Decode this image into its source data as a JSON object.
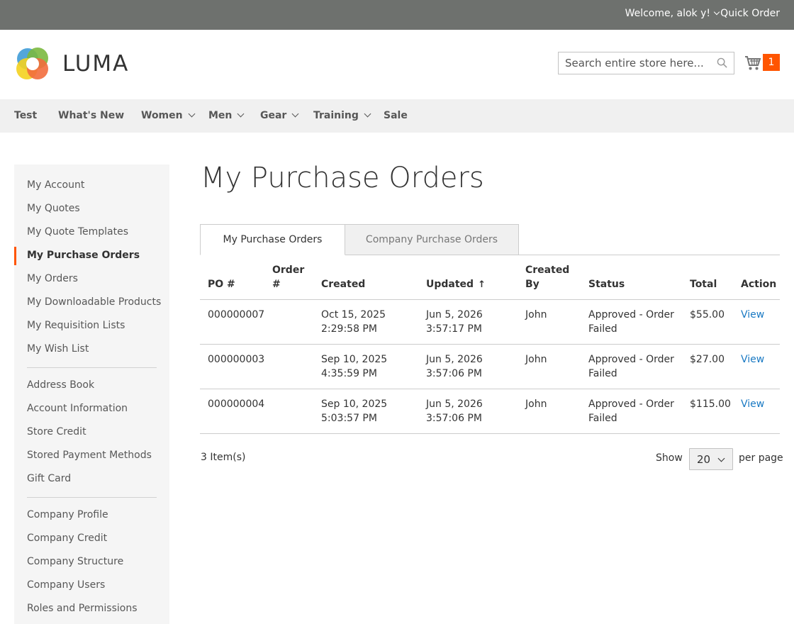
{
  "topbar": {
    "welcome": "Welcome, alok y!",
    "quick_order": "Quick Order"
  },
  "header": {
    "logo_text": "LUMA",
    "search_placeholder": "Search entire store here...",
    "cart_count": "1"
  },
  "nav": {
    "items": [
      "Test",
      "What's New",
      "Women",
      "Men",
      "Gear",
      "Training",
      "Sale"
    ]
  },
  "sidebar": {
    "group1": [
      "My Account",
      "My Quotes",
      "My Quote Templates",
      "My Purchase Orders",
      "My Orders",
      "My Downloadable Products",
      "My Requisition Lists",
      "My Wish List"
    ],
    "group2": [
      "Address Book",
      "Account Information",
      "Store Credit",
      "Stored Payment Methods",
      "Gift Card"
    ],
    "group3": [
      "Company Profile",
      "Company Credit",
      "Company Structure",
      "Company Users",
      "Roles and Permissions"
    ],
    "active": "My Purchase Orders"
  },
  "main": {
    "title": "My Purchase Orders",
    "tabs": [
      "My Purchase Orders",
      "Company Purchase Orders"
    ],
    "columns": {
      "po": "PO #",
      "order_line1": "Order",
      "order_line2": "#",
      "created": "Created",
      "updated": "Updated",
      "updated_sort": "↑",
      "created_by_line1": "Created",
      "created_by_line2": "By",
      "status": "Status",
      "total": "Total",
      "action": "Action"
    },
    "rows": [
      {
        "po": "000000007",
        "order": "",
        "created_date": "Oct 15, 2025",
        "created_time": "2:29:58 PM",
        "updated_date": "Jun 5, 2026",
        "updated_time": "3:57:17 PM",
        "created_by": "John",
        "status_line1": "Approved - Order",
        "status_line2": "Failed",
        "total": "$55.00",
        "action": "View"
      },
      {
        "po": "000000003",
        "order": "",
        "created_date": "Sep 10, 2025",
        "created_time": "4:35:59 PM",
        "updated_date": "Jun 5, 2026",
        "updated_time": "3:57:06 PM",
        "created_by": "John",
        "status_line1": "Approved - Order",
        "status_line2": "Failed",
        "total": "$27.00",
        "action": "View"
      },
      {
        "po": "000000004",
        "order": "",
        "created_date": "Sep 10, 2025",
        "created_time": "5:03:57 PM",
        "updated_date": "Jun 5, 2026",
        "updated_time": "3:57:06 PM",
        "created_by": "John",
        "status_line1": "Approved - Order",
        "status_line2": "Failed",
        "total": "$115.00",
        "action": "View"
      }
    ],
    "toolbar": {
      "items_count": "3 Item(s)",
      "show_label": "Show",
      "limiter_value": "20",
      "per_page": "per page"
    }
  },
  "colors": {
    "topbar": "#6e716e",
    "accent": "#ff5501",
    "link": "#1979c3",
    "nav_bg": "#f0f0f0",
    "sidebar_bg": "#f5f5f5"
  }
}
